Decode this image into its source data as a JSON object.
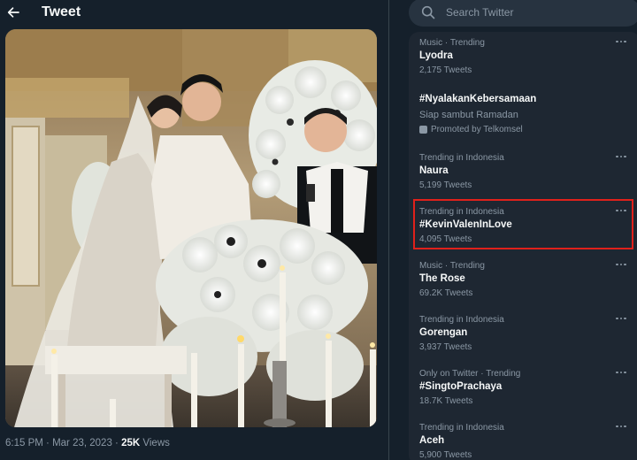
{
  "header": {
    "title": "Tweet"
  },
  "tweet": {
    "time": "6:15 PM",
    "separator": "·",
    "date": "Mar 23, 2023",
    "views_count": "25K",
    "views_label": "Views"
  },
  "search": {
    "placeholder": "Search Twitter"
  },
  "promoted_trend": {
    "name": "#NyalakanKebersamaan",
    "description": "Siap sambut Ramadan",
    "promoted_by": "Promoted by Telkomsel"
  },
  "trends": [
    {
      "context": "Music · Trending",
      "name": "Lyodra",
      "count": "2,175 Tweets"
    },
    {
      "context": "Trending in Indonesia",
      "name": "Naura",
      "count": "5,199 Tweets"
    },
    {
      "context": "Trending in Indonesia",
      "name": "#KevinValenInLove",
      "count": "4,095 Tweets"
    },
    {
      "context": "Music · Trending",
      "name": "The Rose",
      "count": "69.2K Tweets"
    },
    {
      "context": "Trending in Indonesia",
      "name": "Gorengan",
      "count": "3,937 Tweets"
    },
    {
      "context": "Only on Twitter · Trending",
      "name": "#SingtoPrachaya",
      "count": "18.7K Tweets"
    },
    {
      "context": "Trending in Indonesia",
      "name": "Aceh",
      "count": "5,900 Tweets"
    }
  ],
  "colors": {
    "background": "#15202b",
    "panel": "#1e2732",
    "secondary_text": "#8b98a5",
    "highlight": "#e0211b"
  },
  "icons": [
    "back-arrow-icon",
    "search-icon",
    "more-icon",
    "promoted-icon"
  ]
}
